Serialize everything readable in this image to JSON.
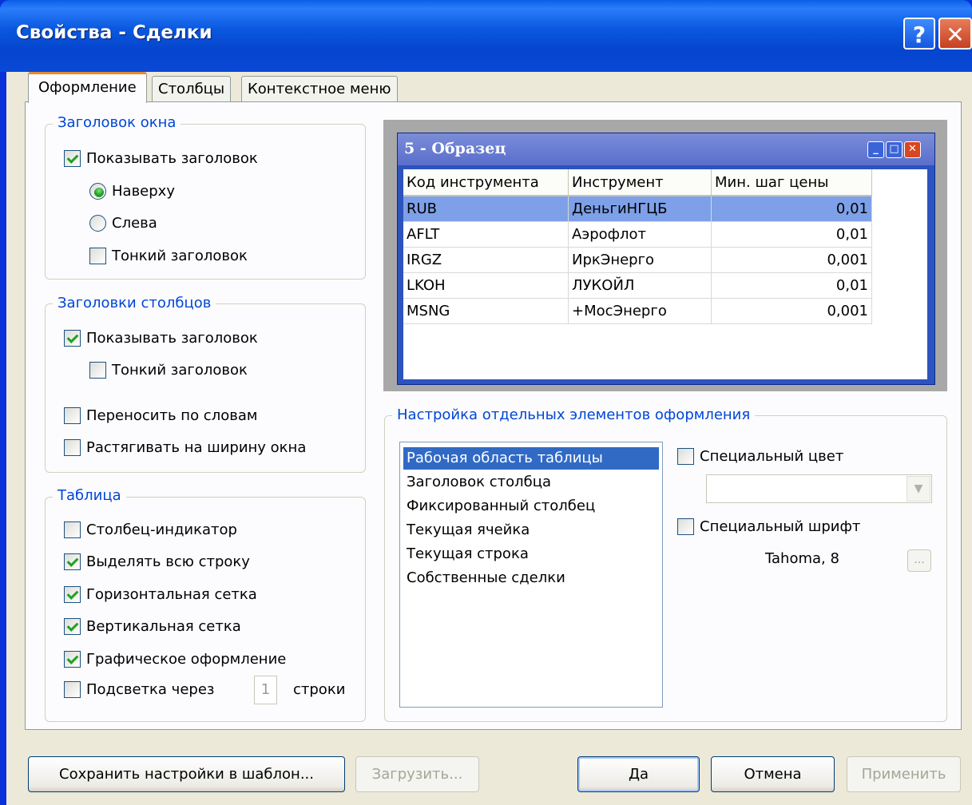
{
  "title_bar": {
    "title": "Свойства - Сделки",
    "help_label": "?",
    "close_label": "✕"
  },
  "tabs": [
    "Оформление",
    "Столбцы",
    "Контекстное меню"
  ],
  "window_header": {
    "title": "Заголовок окна",
    "show_header": {
      "label": "Показывать заголовок",
      "checked": true
    },
    "top": {
      "label": "Наверху",
      "selected": true
    },
    "left": {
      "label": "Слева",
      "selected": false
    },
    "thin_header": {
      "label": "Тонкий заголовок",
      "checked": false
    }
  },
  "column_headers": {
    "title": "Заголовки столбцов",
    "show_header": {
      "label": "Показывать заголовок",
      "checked": true
    },
    "thin_header": {
      "label": "Тонкий заголовок",
      "checked": false
    },
    "word_wrap": {
      "label": "Переносить по словам",
      "checked": false
    },
    "stretch": {
      "label": "Растягивать на ширину окна",
      "checked": false
    }
  },
  "table": {
    "title": "Таблица",
    "indicator_column": {
      "label": "Столбец-индикатор",
      "checked": false
    },
    "select_row": {
      "label": "Выделять всю строку",
      "checked": true
    },
    "horizontal_grid": {
      "label": "Горизонтальная сетка",
      "checked": true
    },
    "vertical_grid": {
      "label": "Вертикальная сетка",
      "checked": true
    },
    "graphic_style": {
      "label": "Графическое оформление",
      "checked": true
    },
    "highlight": {
      "label": "Подсветка через",
      "checked": false,
      "value": "1",
      "suffix": "строки"
    }
  },
  "preview": {
    "title": "5 - Образец",
    "columns": [
      "Код инструмента",
      "Инструмент",
      "Мин. шаг цены"
    ],
    "rows": [
      [
        "RUB",
        "ДеньгиНГЦБ",
        "0,01"
      ],
      [
        "AFLT",
        "Аэрофлот",
        "0,01"
      ],
      [
        "IRGZ",
        "ИркЭнерго",
        "0,001"
      ],
      [
        "LKOH",
        "ЛУКОЙЛ",
        "0,01"
      ],
      [
        "MSNG",
        "+МосЭнерго",
        "0,001"
      ]
    ],
    "selected_row": 0
  },
  "elements": {
    "title": "Настройка отдельных элементов оформления",
    "items": [
      "Рабочая область таблицы",
      "Заголовок столбца",
      "Фиксированный столбец",
      "Текущая ячейка",
      "Текущая строка",
      "Собственные сделки"
    ],
    "selected_index": 0,
    "special_color": {
      "label": "Специальный цвет",
      "checked": false,
      "value": ""
    },
    "special_font": {
      "label": "Специальный шрифт",
      "checked": false
    },
    "font_value": "Tahoma, 8",
    "dots_label": "..."
  },
  "buttons": {
    "save_template": "Сохранить настройки в шаблон...",
    "load": "Загрузить...",
    "ok": "Да",
    "cancel": "Отмена",
    "apply": "Применить"
  },
  "colors": {
    "title_bar": "#0a58df",
    "selection": "#316ac5",
    "group_title": "#0046d5",
    "preview_selection": "#7ea0e8"
  }
}
